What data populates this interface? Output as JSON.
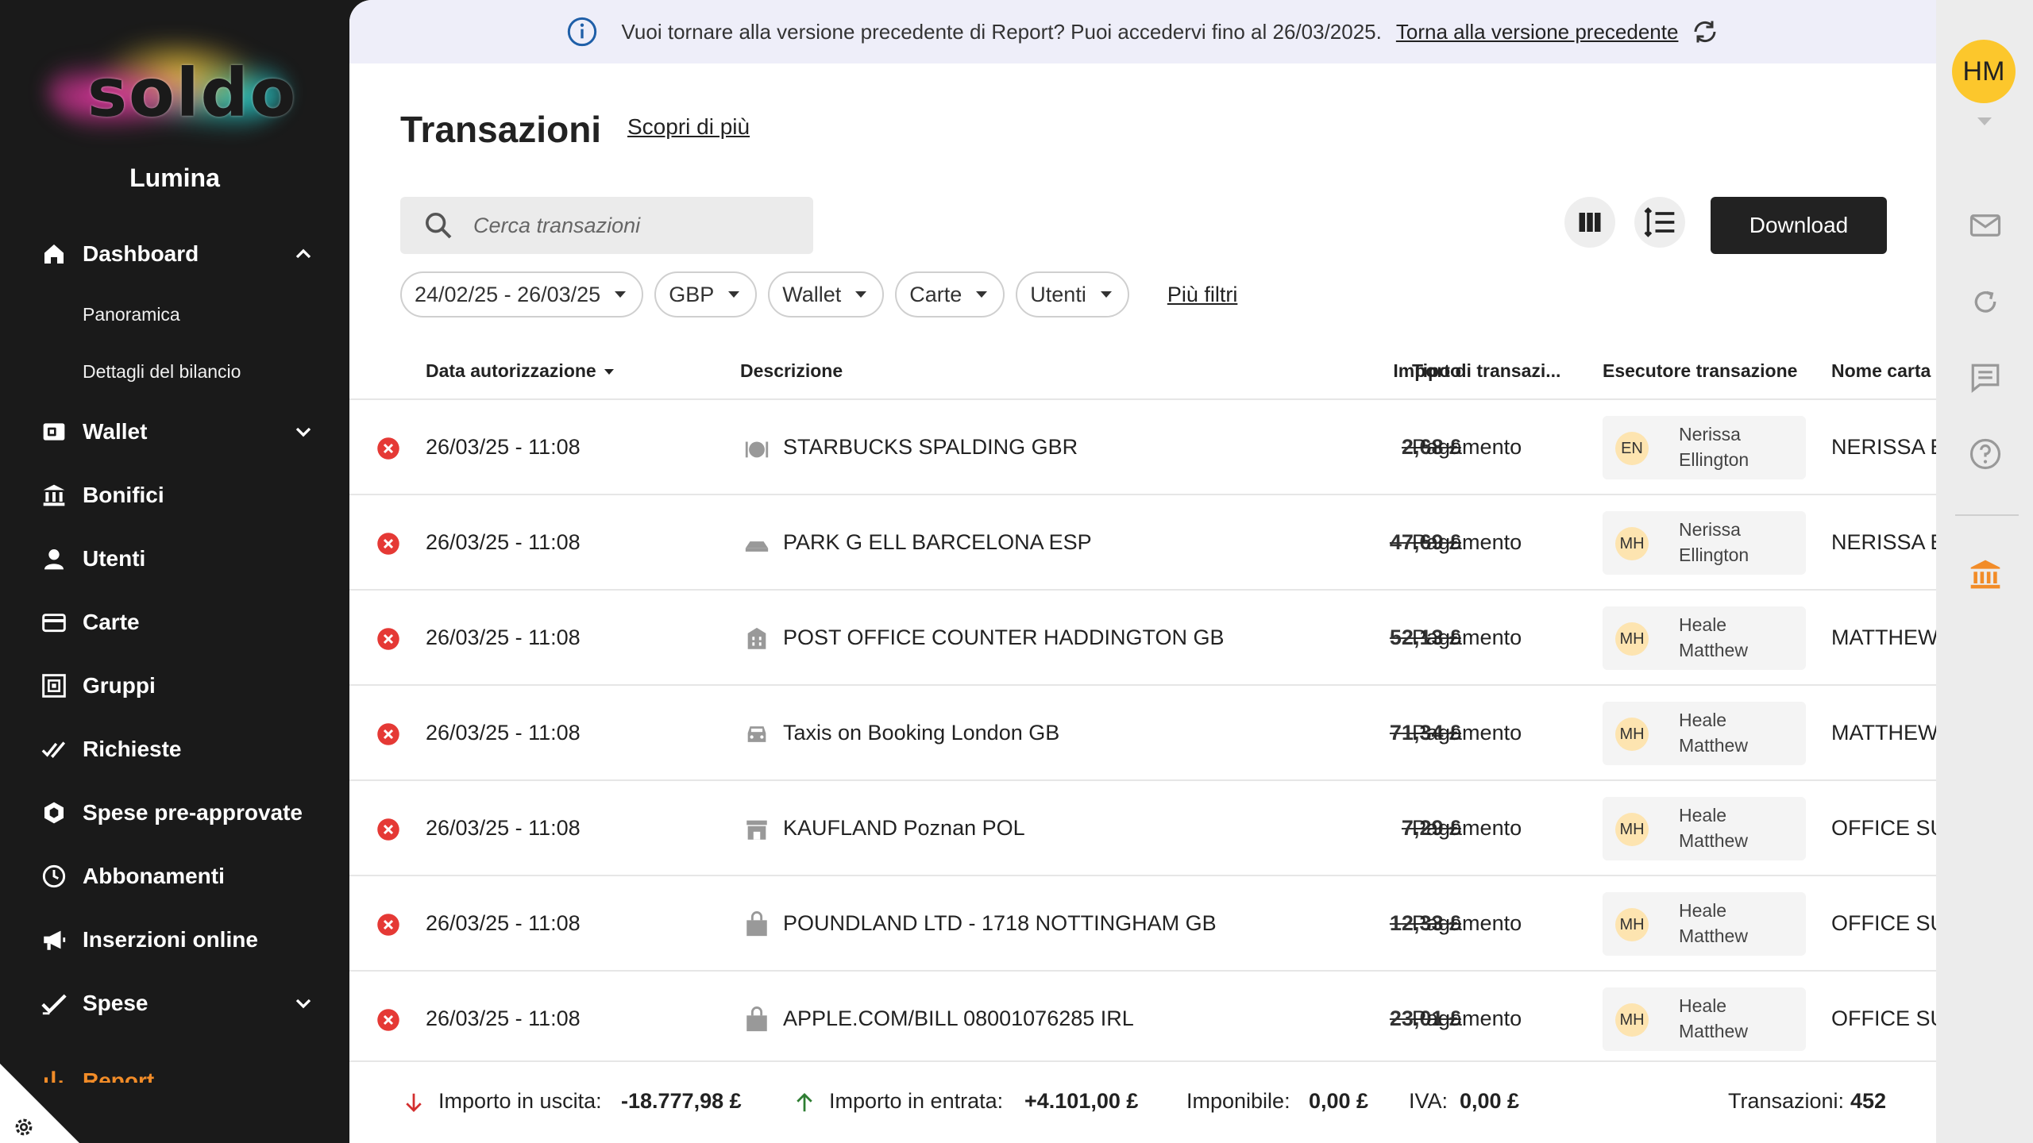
{
  "sidebar": {
    "logo_text": "soldo",
    "org_name": "Lumina",
    "items": [
      {
        "label": "Dashboard",
        "icon": "home-icon",
        "expanded": true
      },
      {
        "label": "Panoramica"
      },
      {
        "label": "Dettagli del bilancio"
      },
      {
        "label": "Wallet",
        "icon": "wallet-icon",
        "expanded": false
      },
      {
        "label": "Bonifici",
        "icon": "bank-transfer-icon"
      },
      {
        "label": "Utenti",
        "icon": "user-icon"
      },
      {
        "label": "Carte",
        "icon": "card-icon"
      },
      {
        "label": "Gruppi",
        "icon": "groups-icon"
      },
      {
        "label": "Richieste",
        "icon": "requests-icon"
      },
      {
        "label": "Spese pre-approvate",
        "icon": "shield-icon"
      },
      {
        "label": "Abbonamenti",
        "icon": "clock-icon"
      },
      {
        "label": "Inserzioni online",
        "icon": "megaphone-icon"
      },
      {
        "label": "Spese",
        "icon": "check-icon",
        "expanded": false
      },
      {
        "label": "Report",
        "icon": "chart-icon",
        "expanded": true
      }
    ]
  },
  "banner": {
    "text": "Vuoi tornare alla versione precedente di Report? Puoi accedervi fino al 26/03/2025.",
    "link": "Torna alla versione precedente"
  },
  "header": {
    "title": "Transazioni",
    "learn_more": "Scopri di più",
    "search_placeholder": "Cerca transazioni",
    "download": "Download"
  },
  "filters": {
    "date_range": "24/02/25 - 26/03/25",
    "currency": "GBP",
    "wallet": "Wallet",
    "cards": "Carte",
    "users": "Utenti",
    "more": "Più filtri"
  },
  "table": {
    "columns": {
      "date": "Data autorizzazione",
      "description": "Descrizione",
      "amount": "Importo",
      "type": "Tipo di transazi...",
      "executor": "Esecutore transazione",
      "card": "Nome carta"
    },
    "rows": [
      {
        "date": "26/03/25 - 11:08",
        "icon": "restaurant-icon",
        "description": "STARBUCKS SPALDING GBR",
        "amount": "2,68 £",
        "type": "Pagamento",
        "initials": "EN",
        "first": "Nerissa",
        "last": "Ellington",
        "card": "NERISSA EL"
      },
      {
        "date": "26/03/25 - 11:08",
        "icon": "parking-icon",
        "description": "PARK G ELL BARCELONA ESP",
        "amount": "47,69 £",
        "type": "Pagamento",
        "initials": "MH",
        "first": "Nerissa",
        "last": "Ellington",
        "card": "NERISSA EL"
      },
      {
        "date": "26/03/25 - 11:08",
        "icon": "building-icon",
        "description": "POST OFFICE COUNTER HADDINGTON GB",
        "amount": "52,13 £",
        "type": "Pagamento",
        "initials": "MH",
        "first": "Heale",
        "last": "Matthew",
        "card": "MATTHEW"
      },
      {
        "date": "26/03/25 - 11:08",
        "icon": "car-icon",
        "description": "Taxis on Booking London GB",
        "amount": "71,34 £",
        "type": "Pagamento",
        "initials": "MH",
        "first": "Heale",
        "last": "Matthew",
        "card": "MATTHEW"
      },
      {
        "date": "26/03/25 - 11:08",
        "icon": "store-icon",
        "description": "KAUFLAND Poznan POL",
        "amount": "7,29 £",
        "type": "Pagamento",
        "initials": "MH",
        "first": "Heale",
        "last": "Matthew",
        "card": "OFFICE SUI"
      },
      {
        "date": "26/03/25 - 11:08",
        "icon": "shopping-bag-icon",
        "description": "POUNDLAND LTD - 1718 NOTTINGHAM GB",
        "amount": "12,33 £",
        "type": "Pagamento",
        "initials": "MH",
        "first": "Heale",
        "last": "Matthew",
        "card": "OFFICE SUI"
      },
      {
        "date": "26/03/25 - 11:08",
        "icon": "shopping-bag-icon",
        "description": "APPLE.COM/BILL 08001076285 IRL",
        "amount": "23,01 £",
        "type": "Pagamento",
        "initials": "MH",
        "first": "Heale",
        "last": "Matthew",
        "card": "OFFICE SUI"
      }
    ]
  },
  "footer": {
    "out_label": "Importo in uscita:",
    "out_value": "-18.777,98 £",
    "in_label": "Importo in entrata:",
    "in_value": "+4.101,00 £",
    "taxable_label": "Imponibile:",
    "taxable_value": "0,00 £",
    "vat_label": "IVA:",
    "vat_value": "0,00 £",
    "count_label": "Transazioni:",
    "count_value": "452"
  },
  "rail": {
    "user_initials": "HM"
  },
  "colors": {
    "sidebar_bg": "#1a1a1a",
    "banner_bg": "#eeeef9",
    "error_red": "#e53935",
    "avatar_yellow": "#fcc72c",
    "accent_orange": "#f28c28"
  }
}
